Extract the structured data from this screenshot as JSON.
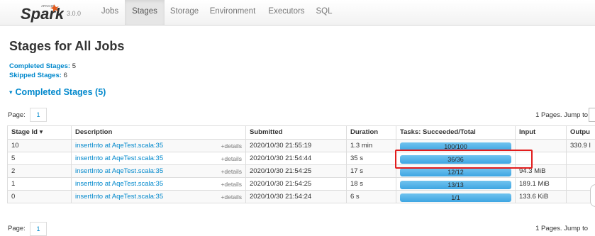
{
  "brand": {
    "logo": "Spark",
    "apache": "APACHE",
    "version": "3.0.0"
  },
  "nav": [
    "Jobs",
    "Stages",
    "Storage",
    "Environment",
    "Executors",
    "SQL"
  ],
  "page_title": "Stages for All Jobs",
  "summary": {
    "completed_label": "Completed Stages:",
    "completed_value": "5",
    "skipped_label": "Skipped Stages:",
    "skipped_value": "6"
  },
  "section": {
    "arrow": "▾",
    "title": "Completed Stages (5)"
  },
  "pager": {
    "label": "Page:",
    "page": "1",
    "right_text": "1 Pages. Jump to"
  },
  "table": {
    "headers": [
      "Stage Id ▾",
      "Description",
      "Submitted",
      "Duration",
      "Tasks: Succeeded/Total",
      "Input",
      "Outpu"
    ],
    "details_label": "+details",
    "rows": [
      {
        "id": "10",
        "desc": "insertInto at AqeTest.scala:35",
        "submitted": "2020/10/30 21:55:19",
        "duration": "1.3 min",
        "tasks": "100/100",
        "progress": 1.0,
        "input": "",
        "output": "330.9 I"
      },
      {
        "id": "5",
        "desc": "insertInto at AqeTest.scala:35",
        "submitted": "2020/10/30 21:54:44",
        "duration": "35 s",
        "tasks": "36/36",
        "progress": 1.0,
        "input": "",
        "output": ""
      },
      {
        "id": "2",
        "desc": "insertInto at AqeTest.scala:35",
        "submitted": "2020/10/30 21:54:25",
        "duration": "17 s",
        "tasks": "12/12",
        "progress": 1.0,
        "input": "94.3 MiB",
        "output": ""
      },
      {
        "id": "1",
        "desc": "insertInto at AqeTest.scala:35",
        "submitted": "2020/10/30 21:54:25",
        "duration": "18 s",
        "tasks": "13/13",
        "progress": 1.0,
        "input": "189.1 MiB",
        "output": ""
      },
      {
        "id": "0",
        "desc": "insertInto at AqeTest.scala:35",
        "submitted": "2020/10/30 21:54:24",
        "duration": "6 s",
        "tasks": "1/1",
        "progress": 1.0,
        "input": "133.6 KiB",
        "output": ""
      }
    ]
  },
  "colors": {
    "link": "#0088cc",
    "progress": "#3ea5e2",
    "highlight": "#e21d1d"
  }
}
